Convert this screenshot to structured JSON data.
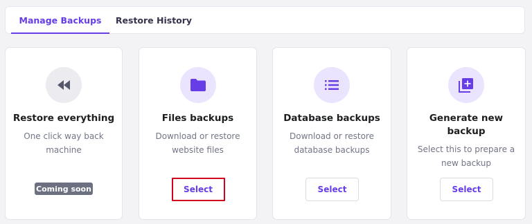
{
  "tabs": [
    {
      "label": "Manage Backups",
      "active": true
    },
    {
      "label": "Restore History",
      "active": false
    }
  ],
  "cards": [
    {
      "icon": "rewind-icon",
      "title": "Restore everything",
      "description": "One click way back machine",
      "badge": "Coming soon"
    },
    {
      "icon": "folder-icon",
      "title": "Files backups",
      "description": "Download or restore website files",
      "button": "Select"
    },
    {
      "icon": "list-icon",
      "title": "Database backups",
      "description": "Download or restore database backups",
      "button": "Select"
    },
    {
      "icon": "add-library-icon",
      "title": "Generate new backup",
      "description": "Select this to prepare a new backup",
      "button": "Select"
    }
  ],
  "colors": {
    "accent": "#673de6",
    "highlight": "#d0021b",
    "badge": "#6d7081"
  }
}
